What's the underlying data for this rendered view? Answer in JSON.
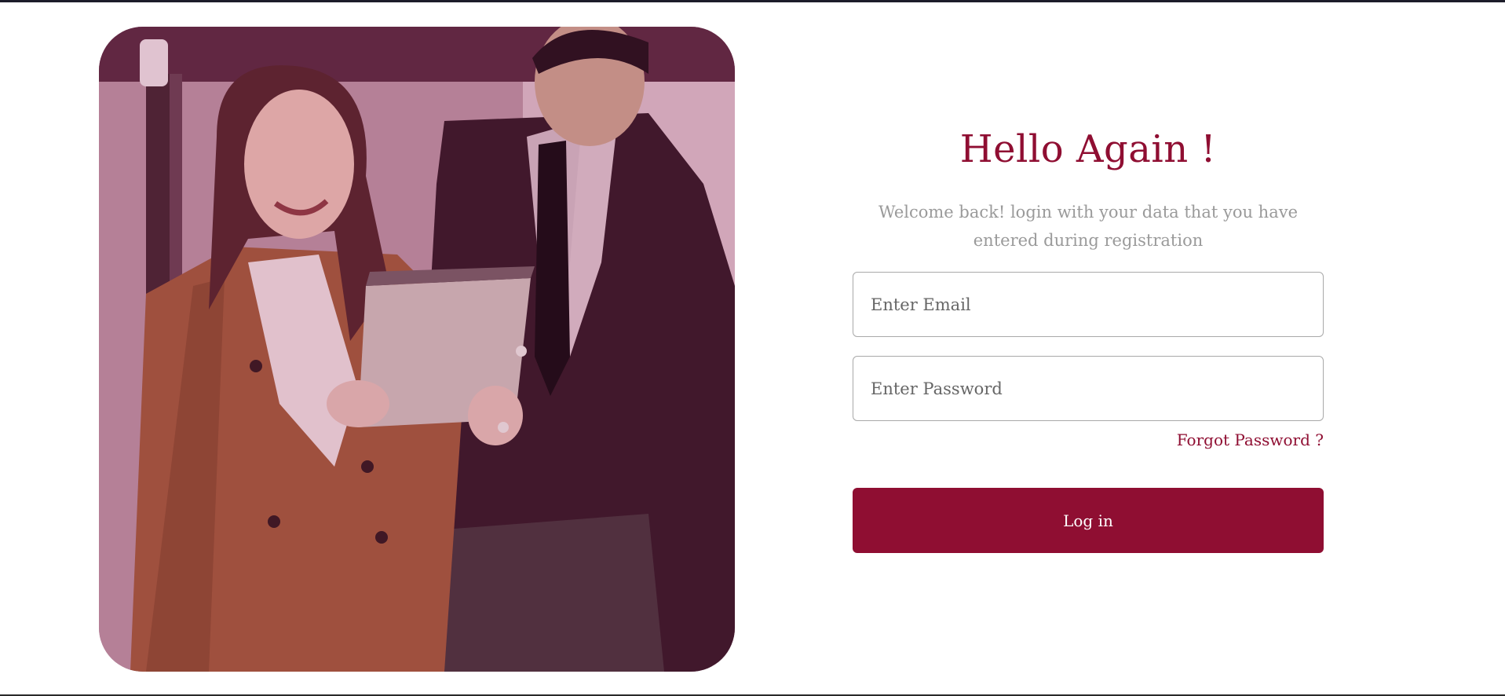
{
  "login": {
    "title": "Hello Again !",
    "subtitle": "Welcome back! login with your data that you have entered during registration",
    "email_placeholder": "Enter Email",
    "email_value": "",
    "password_placeholder": "Enter Password",
    "password_value": "",
    "forgot_link": "Forgot Password ?",
    "login_button": "Log in"
  },
  "colors": {
    "brand": "#8f0e32",
    "subtitle_text": "#9a9a9a",
    "input_border": "#a9a9a9"
  }
}
